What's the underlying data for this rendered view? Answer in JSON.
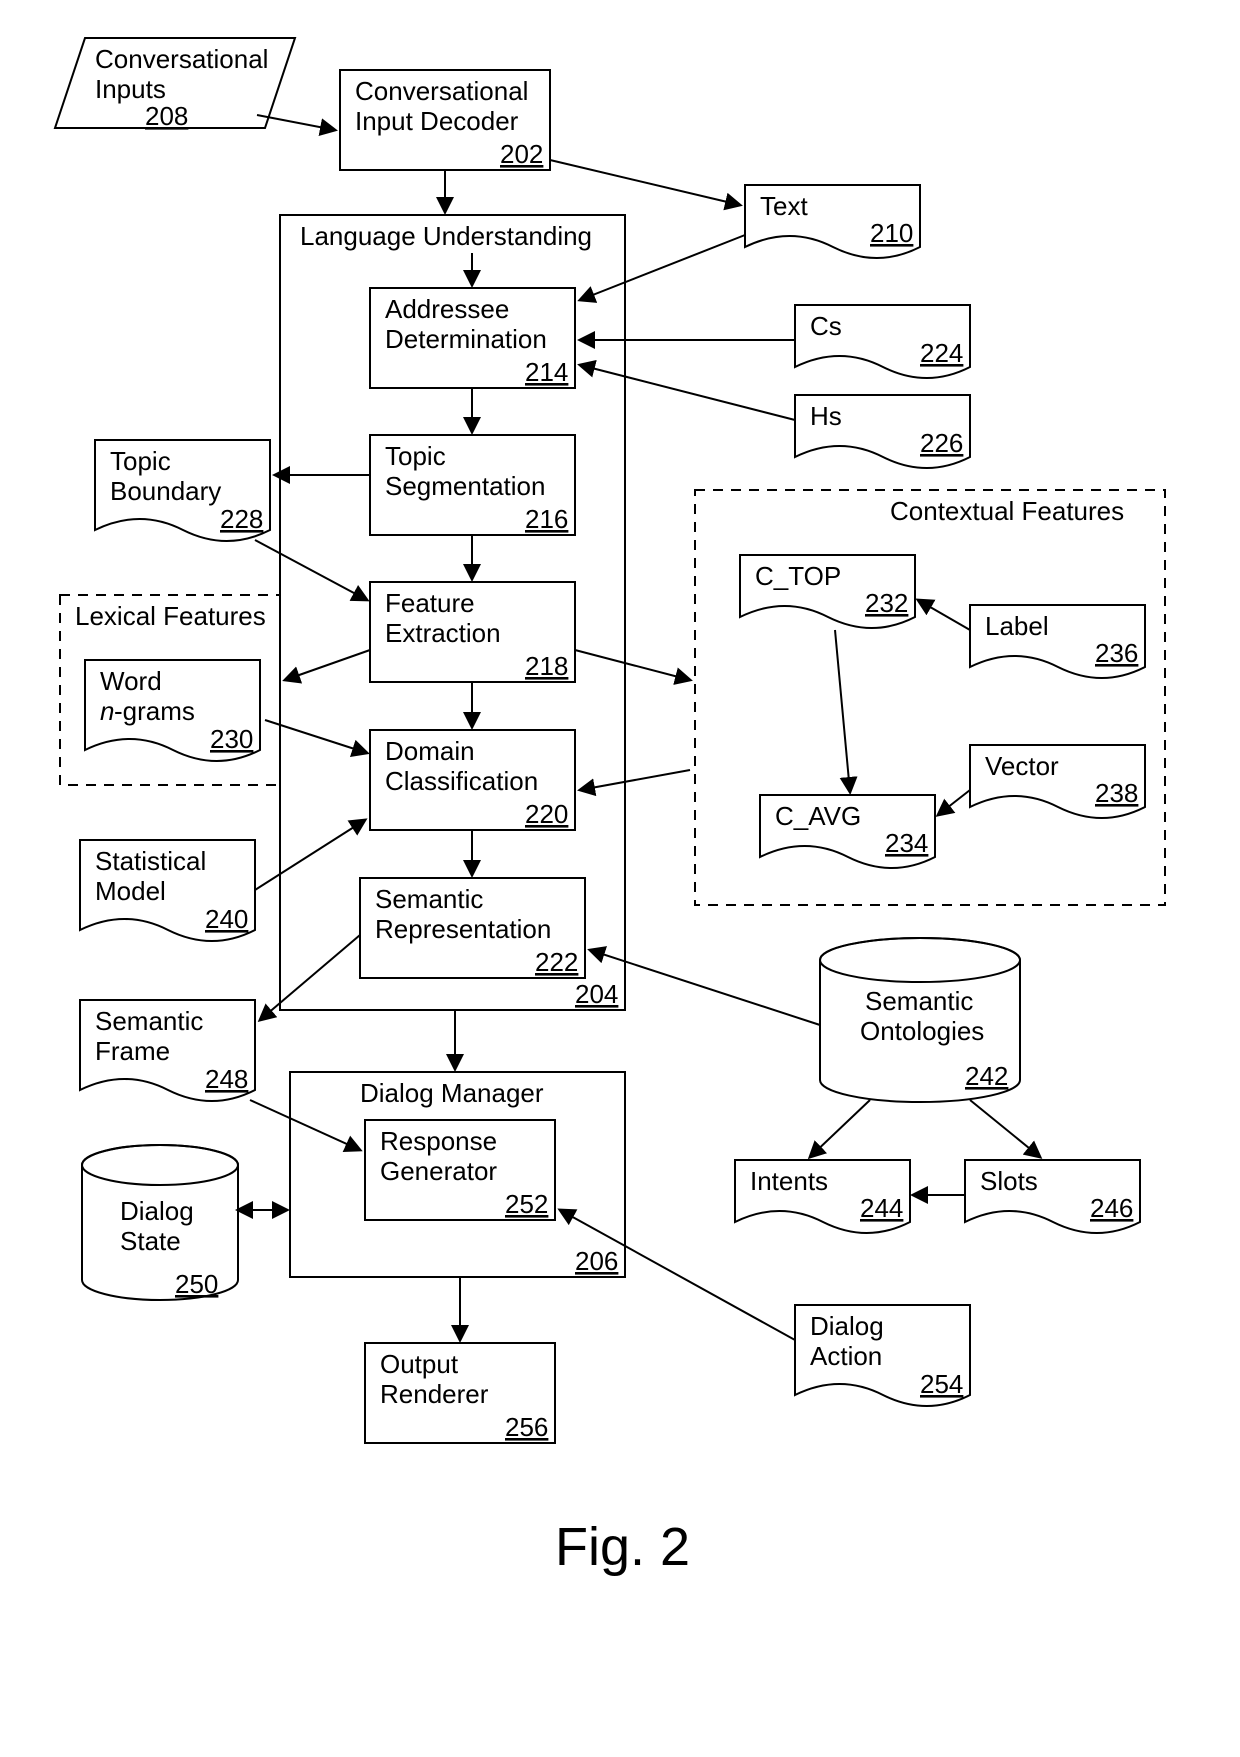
{
  "figure": "Fig. 2",
  "nodes": {
    "n208": {
      "label1": "Conversational",
      "label2": "Inputs",
      "ref": "208"
    },
    "n202": {
      "label1": "Conversational",
      "label2": "Input Decoder",
      "ref": "202"
    },
    "n204": {
      "label": "Language Understanding",
      "ref": "204"
    },
    "n214": {
      "label1": "Addressee",
      "label2": "Determination",
      "ref": "214"
    },
    "n216": {
      "label1": "Topic",
      "label2": "Segmentation",
      "ref": "216"
    },
    "n218": {
      "label1": "Feature",
      "label2": "Extraction",
      "ref": "218"
    },
    "n220": {
      "label1": "Domain",
      "label2": "Classification",
      "ref": "220"
    },
    "n222": {
      "label1": "Semantic",
      "label2": "Representation",
      "ref": "222"
    },
    "n206": {
      "label": "Dialog Manager",
      "ref": "206"
    },
    "n252": {
      "label1": "Response",
      "label2": "Generator",
      "ref": "252"
    },
    "n256": {
      "label1": "Output",
      "label2": "Renderer",
      "ref": "256"
    },
    "n210": {
      "label": "Text",
      "ref": "210"
    },
    "n224": {
      "label": "Cs",
      "ref": "224"
    },
    "n226": {
      "label": "Hs",
      "ref": "226"
    },
    "n228": {
      "label1": "Topic",
      "label2": "Boundary",
      "ref": "228"
    },
    "lexical": {
      "title": "Lexical Features"
    },
    "n230": {
      "label1": "Word",
      "label2": "n-grams",
      "ref": "230"
    },
    "n240": {
      "label1": "Statistical",
      "label2": "Model",
      "ref": "240"
    },
    "n248": {
      "label1": "Semantic",
      "label2": "Frame",
      "ref": "248"
    },
    "n250": {
      "label1": "Dialog",
      "label2": "State",
      "ref": "250"
    },
    "contextual": {
      "title": "Contextual Features"
    },
    "n232": {
      "label": "C_TOP",
      "ref": "232"
    },
    "n234": {
      "label": "C_AVG",
      "ref": "234"
    },
    "n236": {
      "label": "Label",
      "ref": "236"
    },
    "n238": {
      "label": "Vector",
      "ref": "238"
    },
    "n242": {
      "label1": "Semantic",
      "label2": "Ontologies",
      "ref": "242"
    },
    "n244": {
      "label": "Intents",
      "ref": "244"
    },
    "n246": {
      "label": "Slots",
      "ref": "246"
    },
    "n254": {
      "label1": "Dialog",
      "label2": "Action",
      "ref": "254"
    }
  }
}
